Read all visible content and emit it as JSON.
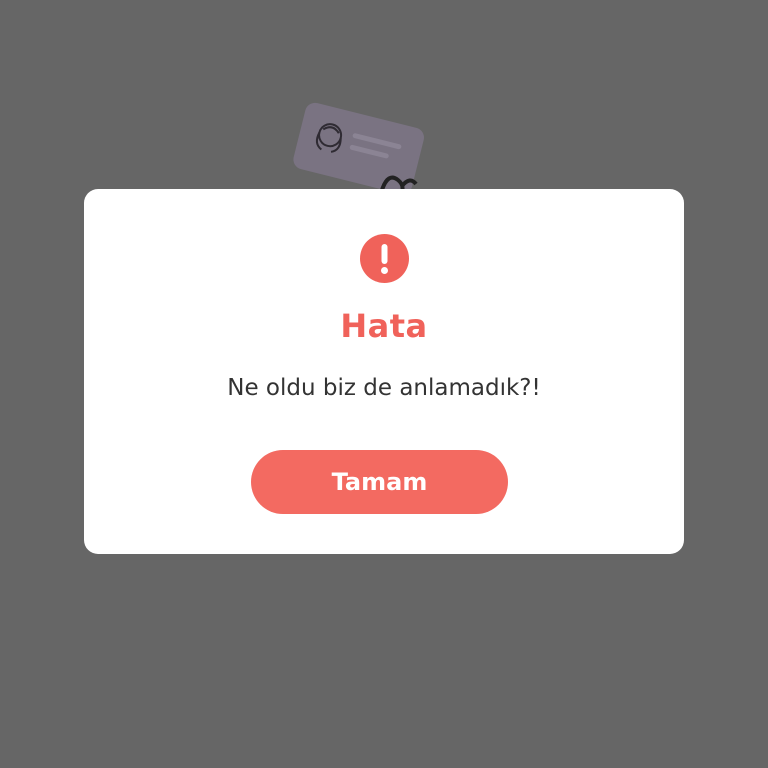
{
  "dialog": {
    "icon": "exclamation-circle-icon",
    "title": "Hata",
    "message": "Ne oldu biz de anlamadık?!",
    "ok_label": "Tamam"
  },
  "illustration": {
    "icon": "id-card-icon"
  },
  "colors": {
    "backdrop": "#666666",
    "accent": "#f0625a",
    "button": "#f36a61",
    "dialog_bg": "#ffffff",
    "text": "#333333"
  }
}
